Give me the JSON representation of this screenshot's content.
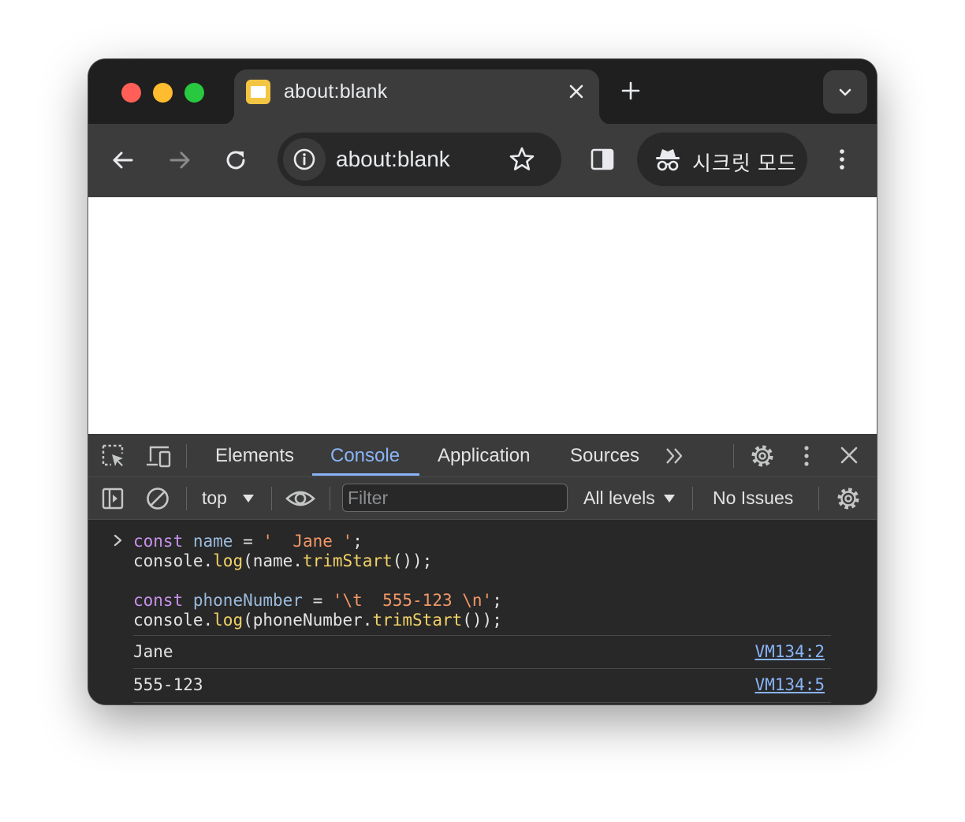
{
  "tab": {
    "title": "about:blank",
    "favicon_icon": "page-favicon-icon",
    "close_icon": "close-icon",
    "new_tab_icon": "plus-icon",
    "tab_search_icon": "chevron-down-icon"
  },
  "toolbar": {
    "back_icon": "arrow-left-icon",
    "forward_icon": "arrow-right-icon",
    "reload_icon": "reload-icon",
    "info_icon": "info-icon",
    "url": "about:blank",
    "bookmark_icon": "star-icon",
    "side_panel_icon": "side-panel-icon",
    "incognito_label": "시크릿 모드",
    "incognito_icon": "incognito-icon",
    "menu_icon": "kebab-menu-icon"
  },
  "devtools": {
    "tabs": [
      {
        "label": "Elements",
        "active": false
      },
      {
        "label": "Console",
        "active": true
      },
      {
        "label": "Application",
        "active": false
      },
      {
        "label": "Sources",
        "active": false
      }
    ],
    "more_tabs_icon": "double-chevron-right-icon",
    "settings_icon": "gear-icon",
    "menu_icon": "kebab-menu-icon",
    "close_icon": "close-icon",
    "inspect_icon": "inspect-element-icon",
    "device_icon": "device-toolbar-icon",
    "console_bar": {
      "sidebar_icon": "console-sidebar-icon",
      "clear_icon": "clear-console-icon",
      "context": "top",
      "live_expression_icon": "eye-icon",
      "filter_placeholder": "Filter",
      "levels": "All levels",
      "issues": "No Issues",
      "settings_icon": "gear-icon"
    },
    "input_code": {
      "line1": {
        "kw": "const",
        "var": "name",
        "eq": " = ",
        "str": "'  Jane '",
        "end": ";"
      },
      "line2": {
        "obj": "console.",
        "fn": "log",
        "a": "(name.",
        "fn2": "trimStart",
        "b": "());"
      },
      "line3": {
        "kw": "const",
        "var": "phoneNumber",
        "eq": " = ",
        "str": "'\\t  555-123 \\n'",
        "end": ";"
      },
      "line4": {
        "obj": "console.",
        "fn": "log",
        "a": "(phoneNumber.",
        "fn2": "trimStart",
        "b": "());"
      }
    },
    "messages": [
      {
        "text": "Jane",
        "source": "VM134:2"
      },
      {
        "text": "555-123",
        "source": "VM134:5"
      }
    ]
  },
  "colors": {
    "keyword": "#c792ea",
    "variable": "#9bbbdc",
    "string": "#f29766",
    "function": "#f2d166",
    "accent": "#8ab4f8"
  }
}
